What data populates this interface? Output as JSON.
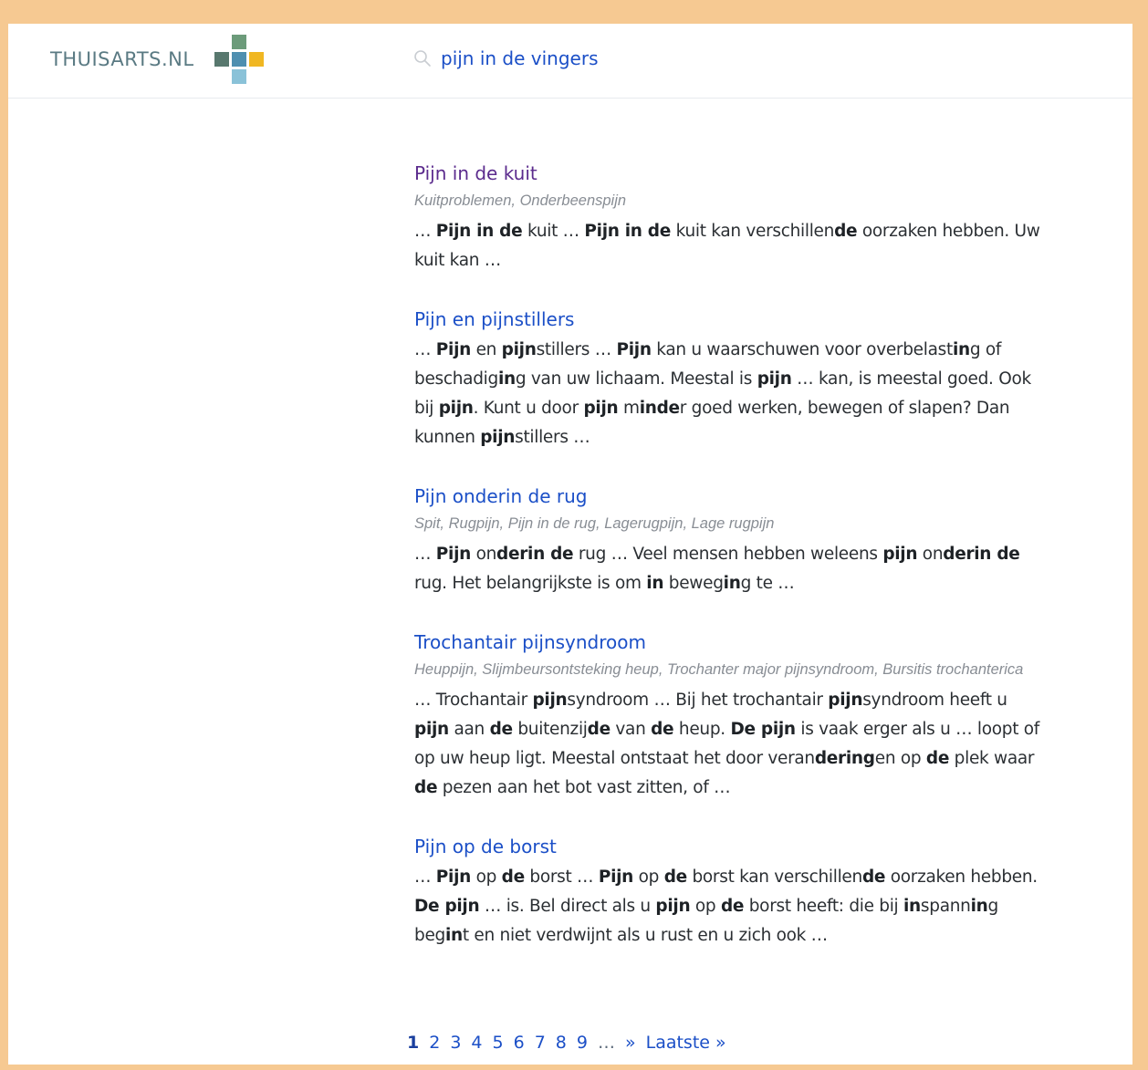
{
  "header": {
    "logo_text": "THUISARTS.NL",
    "search": {
      "value": "pijn in de vingers",
      "placeholder": ""
    }
  },
  "colors": {
    "frame": "#f6c992",
    "link": "#1b4fc7",
    "visited": "#5b2b8d",
    "logo_green": "#6c9b7a",
    "logo_darkgreen": "#58786e",
    "logo_blue": "#4f8fb0",
    "logo_yellow": "#f0b722",
    "logo_lightblue": "#8ac2d8"
  },
  "results": [
    {
      "title": "Pijn in de kuit",
      "visited": true,
      "synonyms": "Kuitproblemen, Onderbeenspijn",
      "snippet": "… <b>Pijn in de</b> kuit … <b>Pijn in de</b> kuit kan verschillen<b>de</b> oorzaken hebben. Uw kuit kan …"
    },
    {
      "title": "Pijn en pijnstillers",
      "visited": false,
      "synonyms": "",
      "snippet": "… <b>Pijn</b> en <b>pijn</b>stillers … <b>Pijn</b> kan u waarschuwen voor overbelast<b>in</b>g of beschadig<b>in</b>g van uw lichaam. Meestal is <b>pijn</b> … kan, is meestal goed. Ook bij <b>pijn</b>. Kunt u door <b>pijn</b> m<b>inde</b>r goed werken, bewegen of slapen? Dan kunnen <b>pijn</b>stillers …"
    },
    {
      "title": "Pijn onderin de rug",
      "visited": false,
      "synonyms": "Spit, Rugpijn, Pijn in de rug, Lagerugpijn, Lage rugpijn",
      "snippet": "… <b>Pijn</b> on<b>derin de</b> rug … Veel mensen hebben weleens <b>pijn</b> on<b>derin de</b> rug. Het belangrijkste is om <b>in</b> beweg<b>in</b>g te …"
    },
    {
      "title": "Trochantair pijnsyndroom",
      "visited": false,
      "synonyms": "Heuppijn, Slijmbeursontsteking heup, Trochanter major pijnsyndroom, Bursitis trochanterica",
      "snippet": "… Trochantair <b>pijn</b>syndroom … Bij het trochantair <b>pijn</b>syndroom heeft u <b>pijn</b> aan <b>de</b> buitenzij<b>de</b> van <b>de</b> heup. <b>De pijn</b> is vaak erger als u … loopt of op uw heup ligt. Meestal ontstaat het door veran<b>dering</b>en op <b>de</b> plek waar <b>de</b> pezen aan het bot vast zitten, of …"
    },
    {
      "title": "Pijn op de borst",
      "visited": false,
      "synonyms": "",
      "snippet": "… <b>Pijn</b> op <b>de</b> borst … <b>Pijn</b> op <b>de</b> borst kan verschillen<b>de</b> oorzaken hebben. <b>De pijn</b> … is. Bel direct als u <b>pijn</b> op <b>de</b> borst heeft: die bij <b>in</b>spann<b>in</b>g beg<b>in</b>t en niet verdwijnt als u rust en u zich ook …"
    }
  ],
  "pagination": {
    "pages": [
      "1",
      "2",
      "3",
      "4",
      "5",
      "6",
      "7",
      "8",
      "9"
    ],
    "current": "1",
    "ellipsis": "…",
    "next": "»",
    "last": "Laatste »"
  }
}
